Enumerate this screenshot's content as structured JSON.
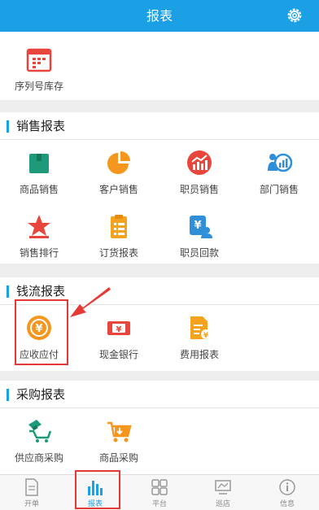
{
  "header": {
    "title": "报表",
    "settings_icon": "gear-icon"
  },
  "top_item": {
    "label": "序列号库存",
    "icon": "serial-calendar-icon"
  },
  "sections": {
    "sales": {
      "title": "销售报表",
      "items": [
        {
          "label": "商品销售",
          "icon": "box-icon"
        },
        {
          "label": "客户销售",
          "icon": "pie-chart-icon"
        },
        {
          "label": "职员销售",
          "icon": "bar-trend-icon"
        },
        {
          "label": "部门销售",
          "icon": "department-chart-icon"
        },
        {
          "label": "销售排行",
          "icon": "star-icon"
        },
        {
          "label": "订货报表",
          "icon": "clipboard-icon"
        },
        {
          "label": "职员回款",
          "icon": "yen-person-icon"
        }
      ]
    },
    "cashflow": {
      "title": "钱流报表",
      "items": [
        {
          "label": "应收应付",
          "icon": "yen-exchange-icon"
        },
        {
          "label": "现金银行",
          "icon": "cash-icon"
        },
        {
          "label": "费用报表",
          "icon": "expense-doc-icon"
        }
      ]
    },
    "purchase": {
      "title": "采购报表",
      "items": [
        {
          "label": "供应商采购",
          "icon": "supplier-cart-icon"
        },
        {
          "label": "商品采购",
          "icon": "cart-icon"
        }
      ]
    }
  },
  "tabbar": [
    {
      "label": "开单",
      "icon": "document-icon",
      "active": false
    },
    {
      "label": "报表",
      "icon": "bar-chart-icon",
      "active": true
    },
    {
      "label": "平台",
      "icon": "grid-icon",
      "active": false
    },
    {
      "label": "巡店",
      "icon": "shop-icon",
      "active": false
    },
    {
      "label": "信息",
      "icon": "info-icon",
      "active": false
    }
  ],
  "colors": {
    "brand": "#1ba0e6",
    "highlight": "#e53935",
    "green": "#1e9a7a",
    "orange": "#f5961e",
    "red": "#e8453c",
    "blue": "#2f8fd8"
  }
}
